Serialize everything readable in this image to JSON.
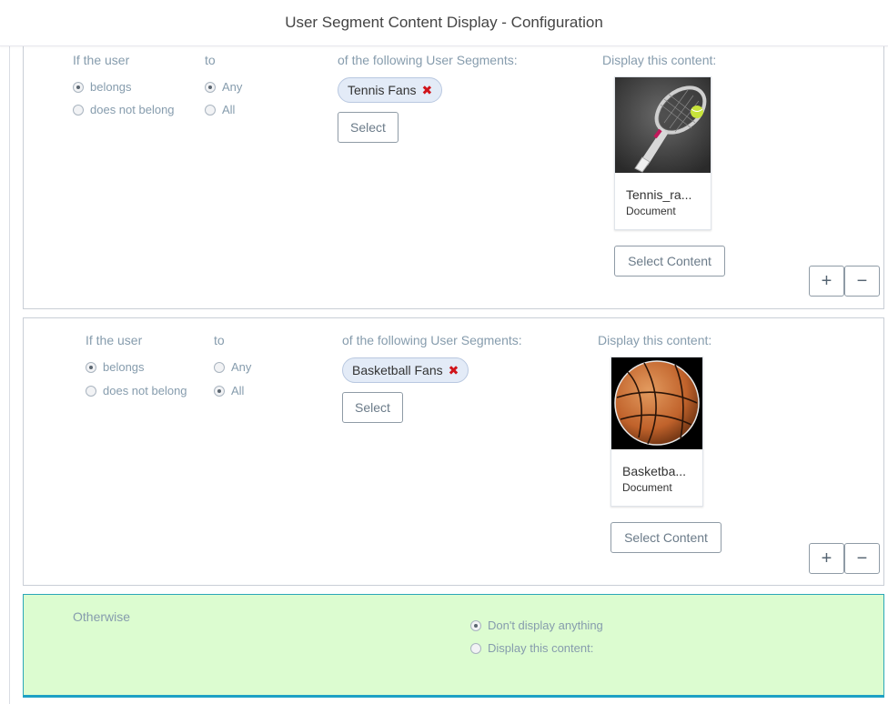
{
  "title": "User Segment Content Display - Configuration",
  "rules": [
    {
      "if_user_label": "If the user",
      "membership_options": [
        "belongs",
        "does not belong"
      ],
      "membership_selected": "belongs",
      "to_label": "to",
      "quantifier_options": [
        "Any",
        "All"
      ],
      "quantifier_selected": "Any",
      "segments_label": "of the following User Segments:",
      "segments": [
        "Tennis Fans"
      ],
      "select_label": "Select",
      "display_label": "Display this content:",
      "content": {
        "name": "Tennis_ra...",
        "type": "Document",
        "icon": "tennis-racket-image"
      },
      "select_content_label": "Select Content",
      "add_label": "+",
      "remove_label": "−"
    },
    {
      "if_user_label": "If the user",
      "membership_options": [
        "belongs",
        "does not belong"
      ],
      "membership_selected": "belongs",
      "to_label": "to",
      "quantifier_options": [
        "Any",
        "All"
      ],
      "quantifier_selected": "All",
      "segments_label": "of the following User Segments:",
      "segments": [
        "Basketball Fans"
      ],
      "select_label": "Select",
      "display_label": "Display this content:",
      "content": {
        "name": "Basketba...",
        "type": "Document",
        "icon": "basketball-image"
      },
      "select_content_label": "Select Content",
      "add_label": "+",
      "remove_label": "−"
    }
  ],
  "otherwise": {
    "label": "Otherwise",
    "options": [
      "Don't display anything",
      "Display this content:"
    ],
    "selected": "Don't display anything",
    "bg_color": "#dcfcd0"
  },
  "colors": {
    "remove_x": "#d0141a",
    "chip_bg": "#e3ebf7",
    "label": "#869cad"
  }
}
